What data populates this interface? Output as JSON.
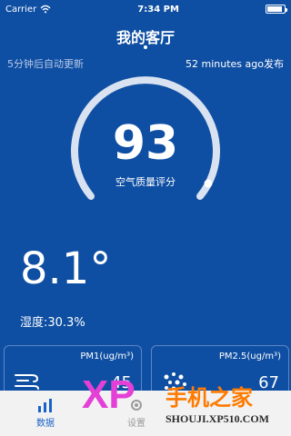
{
  "status_bar": {
    "carrier": "Carrier",
    "time": "7:34 PM"
  },
  "header": {
    "title": "我的客厅"
  },
  "meta": {
    "refresh_note": "5分钟后自动更新",
    "publish_note": "52 minutes ago发布"
  },
  "score": {
    "value": "93",
    "label": "空气质量评分"
  },
  "climate": {
    "temperature": "8.1°",
    "humidity": "湿度:30.3%"
  },
  "cards": [
    {
      "title": "PM1(ug/m³)",
      "value": "45",
      "icon": "wind-icon"
    },
    {
      "title": "PM2.5(ug/m³)",
      "value": "67",
      "icon": "particles-icon"
    }
  ],
  "tabs": [
    {
      "label": "数据",
      "icon": "bar-chart-icon"
    },
    {
      "label": "设置",
      "icon": "settings-icon"
    }
  ],
  "watermark": {
    "logo": "XP",
    "brand": "手机之家",
    "domain": "SHOUJI.XP510.COM"
  }
}
